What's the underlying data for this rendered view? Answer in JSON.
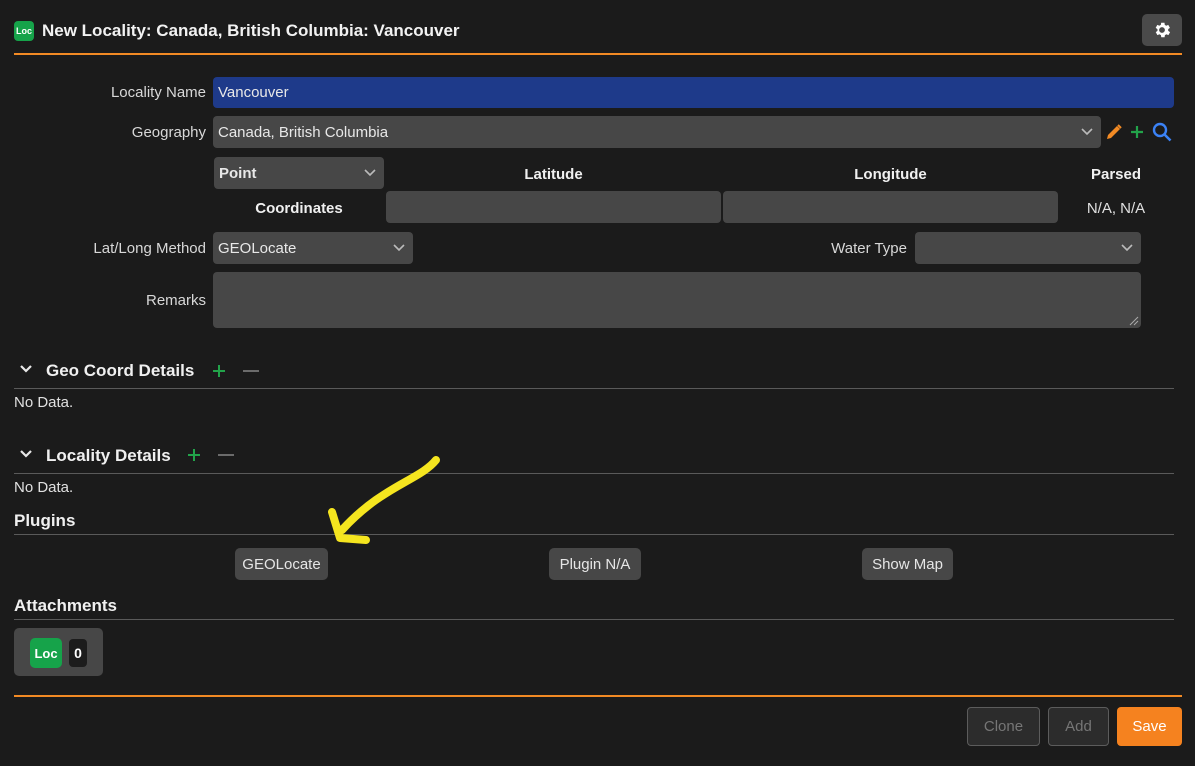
{
  "header": {
    "app_icon_text": "Loc",
    "title": "New Locality: Canada, British Columbia: Vancouver"
  },
  "form": {
    "locality_name": {
      "label": "Locality Name",
      "value": "Vancouver"
    },
    "geography": {
      "label": "Geography",
      "value": "Canada, British Columbia"
    },
    "coordinates": {
      "type_value": "Point",
      "row_label": "Coordinates",
      "latitude_header": "Latitude",
      "longitude_header": "Longitude",
      "parsed_header": "Parsed",
      "parsed_value": "N/A, N/A",
      "latitude_value": "",
      "longitude_value": ""
    },
    "lat_long_method": {
      "label": "Lat/Long Method",
      "value": "GEOLocate"
    },
    "water_type": {
      "label": "Water Type",
      "value": ""
    },
    "remarks": {
      "label": "Remarks",
      "value": ""
    }
  },
  "sections": {
    "geo_coord": {
      "title": "Geo Coord Details",
      "empty": "No Data."
    },
    "locality_details": {
      "title": "Locality Details",
      "empty": "No Data."
    },
    "plugins": {
      "title": "Plugins",
      "buttons": [
        "GEOLocate",
        "Plugin N/A",
        "Show Map"
      ]
    },
    "attachments": {
      "title": "Attachments",
      "icon_text": "Loc",
      "count": "0"
    }
  },
  "footer": {
    "clone": "Clone",
    "add": "Add",
    "save": "Save"
  },
  "colors": {
    "accent_orange": "#f28a24",
    "selected_field": "#1e3a8a",
    "green_plus": "#22a34a",
    "annotation_arrow": "#f5e51f"
  }
}
